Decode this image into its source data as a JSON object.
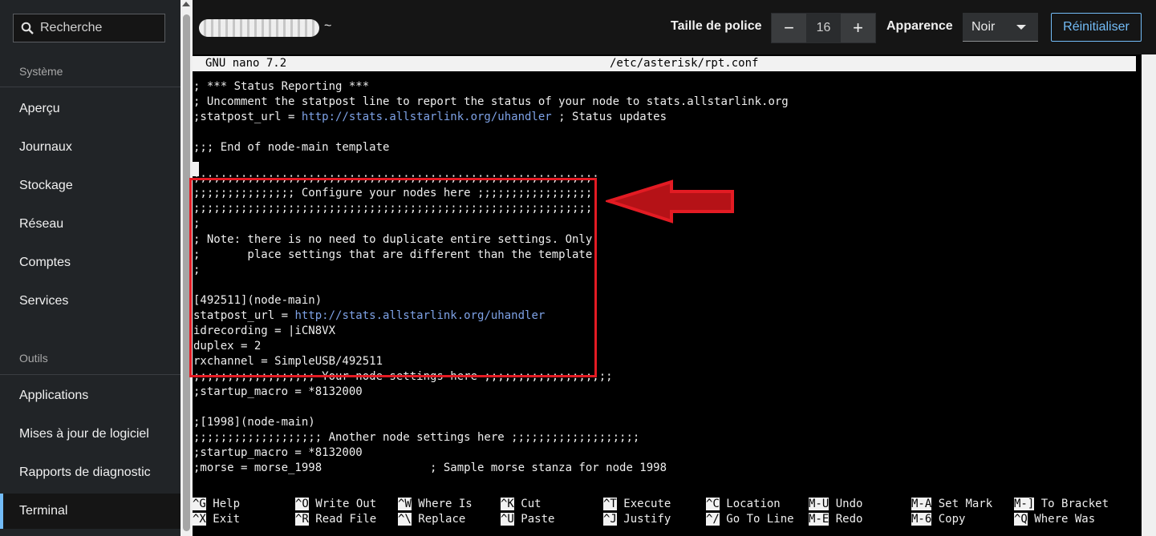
{
  "sidebar": {
    "search_placeholder": "Recherche",
    "sections": [
      {
        "title": "Système",
        "items": [
          "Aperçu",
          "Journaux",
          "Stockage",
          "Réseau",
          "Comptes",
          "Services"
        ]
      },
      {
        "title": "Outils",
        "items": [
          "Applications",
          "Mises à jour de logiciel",
          "Rapports de diagnostic",
          "Terminal"
        ]
      }
    ],
    "active_item": "Terminal"
  },
  "topbar": {
    "host_suffix": "~",
    "font_size_label": "Taille de police",
    "font_size_value": "16",
    "decrement": "−",
    "increment": "+",
    "appearance_label": "Apparence",
    "appearance_value": "Noir",
    "reset_label": "Réinitialiser"
  },
  "terminal": {
    "nano_version": "GNU nano 7.2",
    "file_path": "/etc/asterisk/rpt.conf",
    "lines": [
      {
        "text": "; *** Status Reporting ***"
      },
      {
        "text": "; Uncomment the statpost line to report the status of your node to stats.allstarlink.org"
      },
      {
        "text": ";statpost_url = ",
        "url": "http://stats.allstarlink.org/uhandler",
        "after": " ; Status updates"
      },
      {
        "text": ""
      },
      {
        "text": ";;; End of node-main template"
      },
      {
        "text": ""
      },
      {
        "text": ";;;;;;;;;;;;;;;;;;;;;;;;;;;;;;;;;;;;;;;;;;;;;;;;;;;;;;;;;;;;"
      },
      {
        "text": ";;;;;;;;;;;;;;; Configure your nodes here ;;;;;;;;;;;;;;;;;"
      },
      {
        "text": ";;;;;;;;;;;;;;;;;;;;;;;;;;;;;;;;;;;;;;;;;;;;;;;;;;;;;;;;;;;;"
      },
      {
        "text": ";"
      },
      {
        "text": "; Note: there is no need to duplicate entire settings. Only"
      },
      {
        "text": ";       place settings that are different than the template."
      },
      {
        "text": ";"
      },
      {
        "text": ""
      },
      {
        "text": "[492511](node-main)"
      },
      {
        "text": "statpost_url = ",
        "url": "http://stats.allstarlink.org/uhandler",
        "after": ""
      },
      {
        "text": "idrecording = |iCN8VX"
      },
      {
        "text": "duplex = 2"
      },
      {
        "text": "rxchannel = SimpleUSB/492511"
      },
      {
        "text": ";;;;;;;;;;;;;;;;;; Your node settings here ;;;;;;;;;;;;;;;;;;;"
      },
      {
        "text": ";startup_macro = *8132000"
      },
      {
        "text": ""
      },
      {
        "text": ";[1998](node-main)"
      },
      {
        "text": ";;;;;;;;;;;;;;;;;;; Another node settings here ;;;;;;;;;;;;;;;;;;;"
      },
      {
        "text": ";startup_macro = *8132000"
      },
      {
        "text": ";morse = morse_1998                ; Sample morse stanza for node 1998"
      }
    ],
    "shortcuts": [
      {
        "key": "^G",
        "label": "Help"
      },
      {
        "key": "^X",
        "label": "Exit"
      },
      {
        "key": "^O",
        "label": "Write Out"
      },
      {
        "key": "^R",
        "label": "Read File"
      },
      {
        "key": "^W",
        "label": "Where Is"
      },
      {
        "key": "^\\",
        "label": "Replace"
      },
      {
        "key": "^K",
        "label": "Cut"
      },
      {
        "key": "^U",
        "label": "Paste"
      },
      {
        "key": "^T",
        "label": "Execute"
      },
      {
        "key": "^J",
        "label": "Justify"
      },
      {
        "key": "^C",
        "label": "Location"
      },
      {
        "key": "^/",
        "label": "Go To Line"
      },
      {
        "key": "M-U",
        "label": "Undo"
      },
      {
        "key": "M-E",
        "label": "Redo"
      },
      {
        "key": "M-A",
        "label": "Set Mark"
      },
      {
        "key": "M-6",
        "label": "Copy"
      },
      {
        "key": "M-]",
        "label": "To Bracket"
      },
      {
        "key": "^Q",
        "label": "Where Was"
      }
    ]
  },
  "colors": {
    "accent": "#73bcf7",
    "annotation_red": "#e31b23",
    "url": "#7ea2e6"
  }
}
